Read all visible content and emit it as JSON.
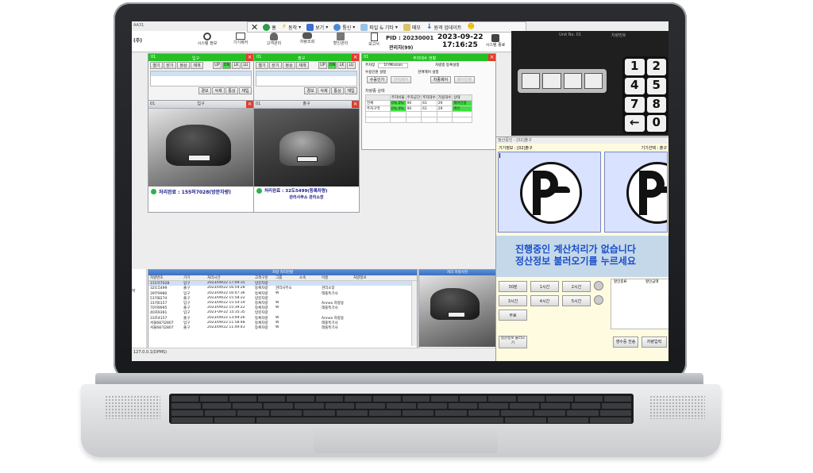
{
  "header": {
    "window_title": "AA31",
    "company": "(주)",
    "nav_buttons": [
      "시스템 정보",
      "기기제어",
      "고객관리",
      "차량조회",
      "할인관리",
      "보고서",
      "시스템 종료"
    ],
    "pid": "PID : 20230001",
    "date": "2023-09-22",
    "time": "17:16:25",
    "admin": "관리자(99)"
  },
  "toolbar": {
    "home": "홈",
    "action": "동작",
    "view": "보기",
    "comm": "통신",
    "file": "파일 & 기타",
    "memo": "메모",
    "update": "원격 업데이트"
  },
  "lanes": [
    {
      "num": "01",
      "title": "입구",
      "gate_buttons": [
        "열기",
        "닫기",
        "정상",
        "재개"
      ],
      "flags": [
        "UP",
        "ON",
        "LK",
        "LU"
      ],
      "actions": [
        "경보",
        "삭제",
        "통상",
        "재입"
      ],
      "cam_title": "입구",
      "plate_text": "처리완료 : 155허7028(방문차량)",
      "extra_text": ""
    },
    {
      "num": "01",
      "title": "출구",
      "gate_buttons": [
        "열기",
        "닫기",
        "정상",
        "재개"
      ],
      "flags": [
        "UP",
        "ON",
        "LK",
        "LU"
      ],
      "actions": [
        "경보",
        "삭제",
        "통상",
        "재입"
      ],
      "cam_title": "출구",
      "plate_text": "처리완료 : 32도5499(등록차량)",
      "extra_text": "관리사무소 관리소장"
    }
  ],
  "status_panel": {
    "title": "주차대수 현황",
    "num": "01",
    "parking_label": "주차장",
    "parking_value": "1F/Mission",
    "left_group": "수용인원 설정",
    "middle_group": "잔여제어 설정",
    "right_group": "차량종 등록설정",
    "buttons": [
      "수동인가",
      "잔여제어",
      "차종제어",
      "제어인정"
    ],
    "subtitle": "차량종 상태",
    "columns": [
      "",
      "주차비율",
      "주차공간",
      "주차대수",
      "가용대수",
      "상태"
    ],
    "rows": [
      [
        "전체",
        "0% 0%",
        "90",
        "61",
        "29",
        "제어안함"
      ],
      [
        "주차구역",
        "0% 0%",
        "90",
        "61",
        "29",
        "여유"
      ],
      [
        "",
        "",
        "",
        "",
        "",
        ""
      ],
      [
        "",
        "",
        "",
        "",
        "",
        ""
      ]
    ]
  },
  "keypad": {
    "header_left": "Unit No. 01",
    "header_right": "차량번호",
    "keys": [
      "1",
      "2",
      "4",
      "5",
      "7",
      "8",
      "←",
      "0"
    ]
  },
  "payment": {
    "window_title": "정산중인 - [02]출구",
    "device_label": "기기정보 : [02]출구",
    "device_select": "기기선택 : 출구",
    "message_line1": "진행중인 계산처리가 없습니다",
    "message_line2": "정산정보 불러오기를 누르세요",
    "durations": [
      "30분",
      "1시간",
      "2시간",
      "3시간",
      "4시간",
      "5시간",
      "무료"
    ],
    "discount_col1": "할인종류",
    "discount_col2": "할인금액",
    "load_button": "정산정보 불러오기",
    "receipt_button": "영수증 전송",
    "next_button": "차량입력"
  },
  "history": {
    "title": "차량 처리현황",
    "columns": [
      "차량번호",
      "기기",
      "처리시간",
      "고객구분",
      "그룹",
      "소속",
      "이름",
      "처량정보"
    ],
    "rows": [
      [
        "155허7028",
        "입구",
        "2023/09/22 17:09:35",
        "방문차량",
        "",
        "",
        "",
        ""
      ],
      [
        "32도5499",
        "출구",
        "2023/09/22 16:59:28",
        "등록차량",
        "관리사무소",
        "",
        "관리소장",
        ""
      ],
      [
        "39무9980",
        "입구",
        "2023/09/22 16:07:36",
        "등록차량",
        "W",
        "",
        "래플특기사",
        ""
      ],
      [
        "51허8274",
        "출구",
        "2023/09/22 15:58:22",
        "방문차량",
        "",
        "",
        "",
        ""
      ],
      [
        "31허6157",
        "입구",
        "2023/09/22 15:54:19",
        "등록차량",
        "W",
        "",
        "Annex 차량용",
        ""
      ],
      [
        "70허9995",
        "출구",
        "2023/09/22 15:39:22",
        "등록차량",
        "W",
        "",
        "래플특기사",
        ""
      ],
      [
        "40차9391",
        "입구",
        "2023-09-22 15:35:35",
        "방문차량",
        "",
        "",
        "",
        ""
      ],
      [
        "33조4157",
        "출구",
        "2023/09/22 13:09:26",
        "등록차량",
        "W",
        "",
        "Annex 차량용",
        ""
      ],
      [
        "서울68가2807",
        "입구",
        "2023/09/22 11:58:48",
        "등록차량",
        "W",
        "",
        "래플특기사",
        ""
      ],
      [
        "서울68가2807",
        "출구",
        "2023/09/22 11:49:43",
        "등록차량",
        "W",
        "",
        "래플특기사",
        ""
      ]
    ]
  },
  "preview": {
    "title": "처리 차량사진"
  },
  "footer": {
    "status": "127.0.0.1(DPMS)"
  },
  "left_edge": {
    "label": "자"
  }
}
